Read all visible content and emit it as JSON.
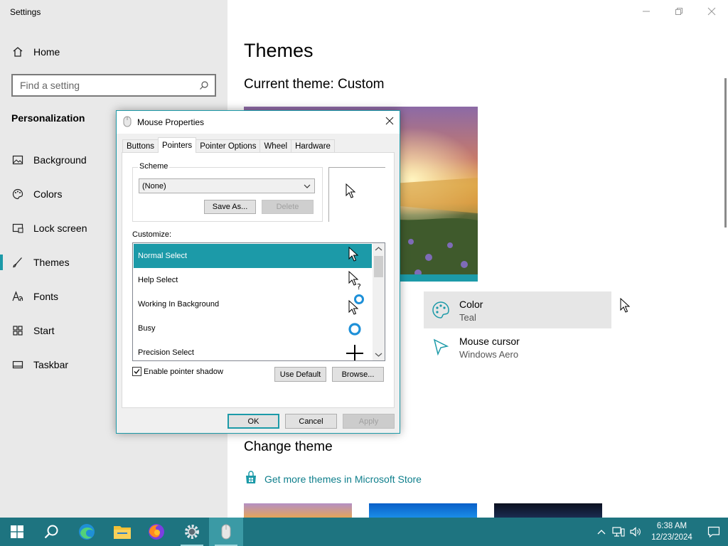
{
  "window": {
    "title": "Settings"
  },
  "sidebar": {
    "home_label": "Home",
    "search_placeholder": "Find a setting",
    "section_title": "Personalization",
    "items": [
      {
        "label": "Background",
        "icon": "image-icon"
      },
      {
        "label": "Colors",
        "icon": "palette-icon"
      },
      {
        "label": "Lock screen",
        "icon": "lock-screen-icon"
      },
      {
        "label": "Themes",
        "icon": "brush-icon",
        "active": true
      },
      {
        "label": "Fonts",
        "icon": "font-icon"
      },
      {
        "label": "Start",
        "icon": "start-grid-icon"
      },
      {
        "label": "Taskbar",
        "icon": "taskbar-icon"
      }
    ]
  },
  "main": {
    "title": "Themes",
    "current_theme_label": "Current theme:",
    "current_theme_value": "Custom",
    "tiles": {
      "color": {
        "label": "Color",
        "value": "Teal"
      },
      "cursor": {
        "label": "Mouse cursor",
        "value": "Windows Aero"
      }
    },
    "change_theme_title": "Change theme",
    "store_link": "Get more themes in Microsoft Store"
  },
  "dialog": {
    "title": "Mouse Properties",
    "tabs": [
      "Buttons",
      "Pointers",
      "Pointer Options",
      "Wheel",
      "Hardware"
    ],
    "active_tab": "Pointers",
    "scheme_label": "Scheme",
    "scheme_value": "(None)",
    "save_as": "Save As...",
    "delete": "Delete",
    "customize_label": "Customize:",
    "cursors": [
      {
        "name": "Normal Select",
        "selected": true
      },
      {
        "name": "Help Select"
      },
      {
        "name": "Working In Background"
      },
      {
        "name": "Busy"
      },
      {
        "name": "Precision Select"
      }
    ],
    "enable_shadow": "Enable pointer shadow",
    "use_default": "Use Default",
    "browse": "Browse...",
    "ok": "OK",
    "cancel": "Cancel",
    "apply": "Apply"
  },
  "taskbar": {
    "time": "6:38 AM",
    "date": "12/23/2024"
  },
  "colors": {
    "accent": "#1c9aa8",
    "taskbar": "#1e7480",
    "sidebar": "#e9e9e9"
  }
}
